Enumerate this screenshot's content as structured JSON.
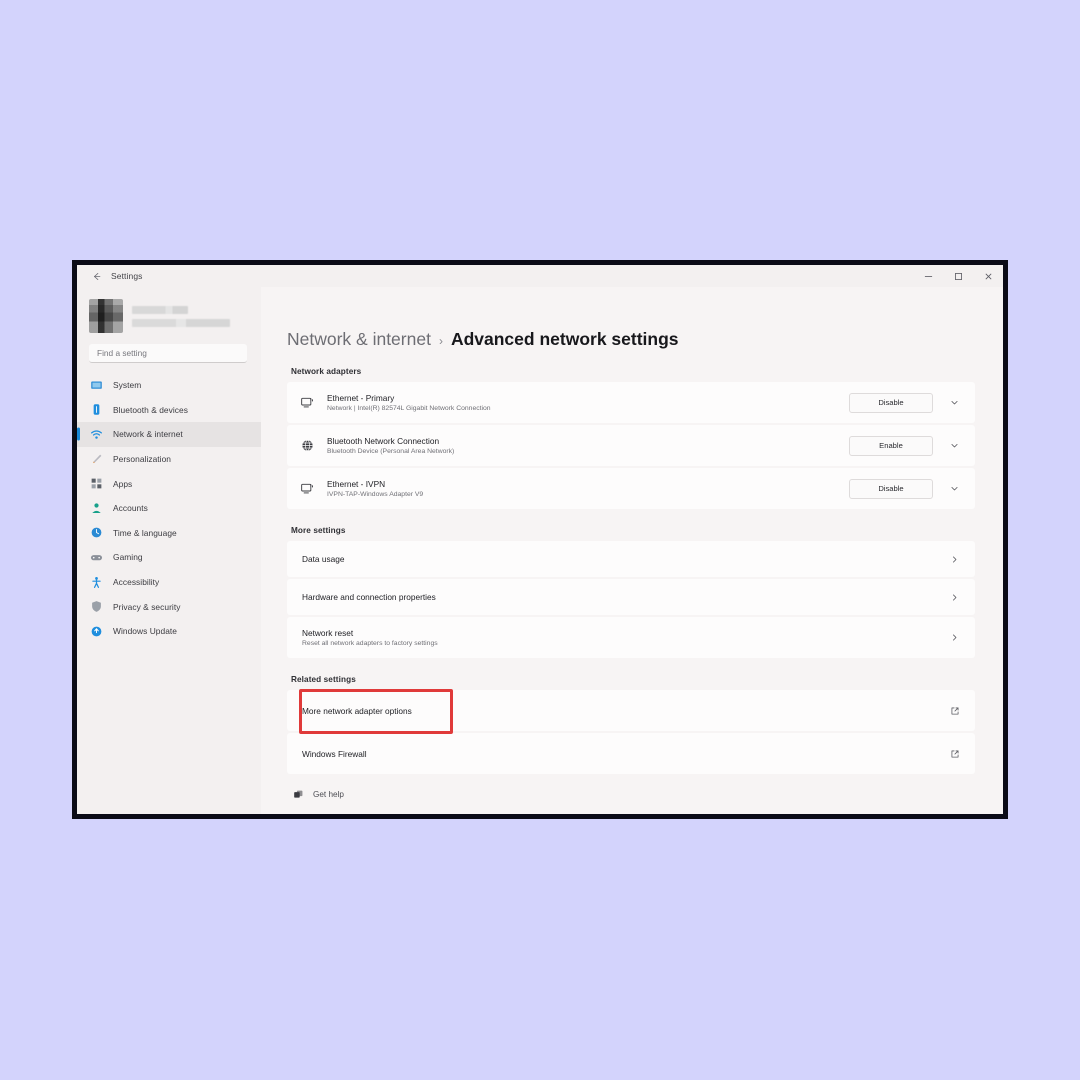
{
  "page": {
    "background_color": "#d3d3fc",
    "window_border_color": "#0b0b17"
  },
  "titlebar": {
    "back_icon": "back-arrow-icon",
    "app_title": "Settings",
    "controls": [
      {
        "name": "minimize-button",
        "icon": "minimize-icon"
      },
      {
        "name": "maximize-button",
        "icon": "maximize-icon"
      },
      {
        "name": "close-button",
        "icon": "close-icon"
      }
    ]
  },
  "sidebar": {
    "account": {
      "avatar_icon": "user-avatar-pixelated",
      "name": "",
      "email": "",
      "redacted": true
    },
    "search": {
      "placeholder": "Find a setting",
      "value": "",
      "icon": "search-icon"
    },
    "items": [
      {
        "label": "System",
        "icon": "monitor-icon",
        "active": false,
        "color": "#2a8ad4"
      },
      {
        "label": "Bluetooth & devices",
        "icon": "bluetooth-icon",
        "active": false,
        "color": "#1f8ede"
      },
      {
        "label": "Network & internet",
        "icon": "wifi-icon",
        "active": true,
        "color": "#1f8ede"
      },
      {
        "label": "Personalization",
        "icon": "paintbrush-icon",
        "active": false,
        "color": "#e08a3c"
      },
      {
        "label": "Apps",
        "icon": "apps-grid-icon",
        "active": false,
        "color": "#5b6068"
      },
      {
        "label": "Accounts",
        "icon": "person-icon",
        "active": false,
        "color": "#17a08a"
      },
      {
        "label": "Time & language",
        "icon": "clock-globe-icon",
        "active": false,
        "color": "#2a8ad4"
      },
      {
        "label": "Gaming",
        "icon": "gamepad-icon",
        "active": false,
        "color": "#6b7079"
      },
      {
        "label": "Accessibility",
        "icon": "accessibility-icon",
        "active": false,
        "color": "#1f8ede"
      },
      {
        "label": "Privacy & security",
        "icon": "shield-icon",
        "active": false,
        "color": "#6b7079"
      },
      {
        "label": "Windows Update",
        "icon": "update-icon",
        "active": false,
        "color": "#1f8ede"
      }
    ]
  },
  "header": {
    "breadcrumb_parent": "Network & internet",
    "breadcrumb_separator": "›",
    "breadcrumb_current": "Advanced network settings"
  },
  "sections": {
    "network_adapters": {
      "heading": "Network adapters",
      "rows": [
        {
          "title": "Ethernet - Primary",
          "subtitle": "Network | Intel(R) 82574L Gigabit Network Connection",
          "icon": "ethernet-icon",
          "button_label": "Disable",
          "chevron": "chevron-down-icon"
        },
        {
          "title": "Bluetooth Network Connection",
          "subtitle": "Bluetooth Device (Personal Area Network)",
          "icon": "globe-icon",
          "button_label": "Enable",
          "chevron": "chevron-down-icon"
        },
        {
          "title": "Ethernet - IVPN",
          "subtitle": "IVPN-TAP-Windows Adapter V9",
          "icon": "ethernet-icon",
          "button_label": "Disable",
          "chevron": "chevron-down-icon"
        }
      ]
    },
    "more_settings": {
      "heading": "More settings",
      "rows": [
        {
          "title": "Data usage",
          "subtitle": "",
          "chevron": "chevron-right-icon"
        },
        {
          "title": "Hardware and connection properties",
          "subtitle": "",
          "chevron": "chevron-right-icon"
        },
        {
          "title": "Network reset",
          "subtitle": "Reset all network adapters to factory settings",
          "chevron": "chevron-right-icon"
        }
      ]
    },
    "related_settings": {
      "heading": "Related settings",
      "rows": [
        {
          "title": "More network adapter options",
          "icon": "external-link-icon",
          "highlighted": true
        },
        {
          "title": "Windows Firewall",
          "icon": "external-link-icon",
          "highlighted": false
        }
      ]
    }
  },
  "footer": {
    "get_help_label": "Get help",
    "get_help_icon": "help-icon"
  },
  "annotation": {
    "highlight_color": "#e03a3a",
    "highlight_target": "More network adapter options"
  }
}
